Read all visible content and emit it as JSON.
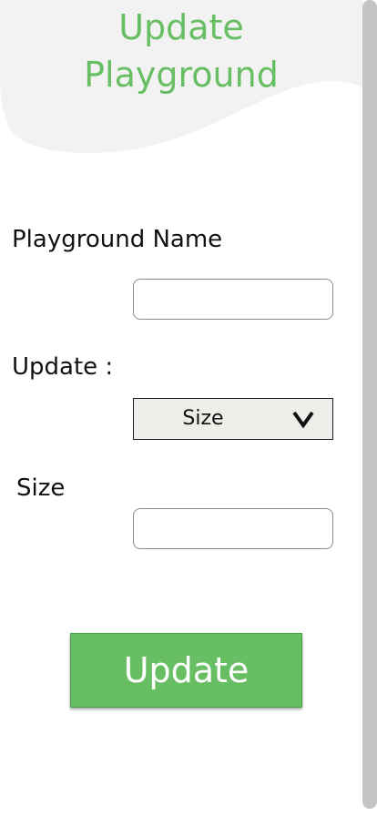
{
  "header": {
    "title_line1": "Update",
    "title_line2": "Playground"
  },
  "form": {
    "name_label": "Playground Name",
    "name_value": "",
    "update_label": "Update :",
    "update_select": {
      "selected": "Size",
      "icon": "chevron-down-icon"
    },
    "size_label": "Size",
    "size_value": ""
  },
  "actions": {
    "update_label": "Update"
  },
  "colors": {
    "accent": "#68bf63",
    "header_bg": "#f2f2f2",
    "select_bg": "#efedea",
    "scrollbar_thumb": "#c4c4c4"
  }
}
